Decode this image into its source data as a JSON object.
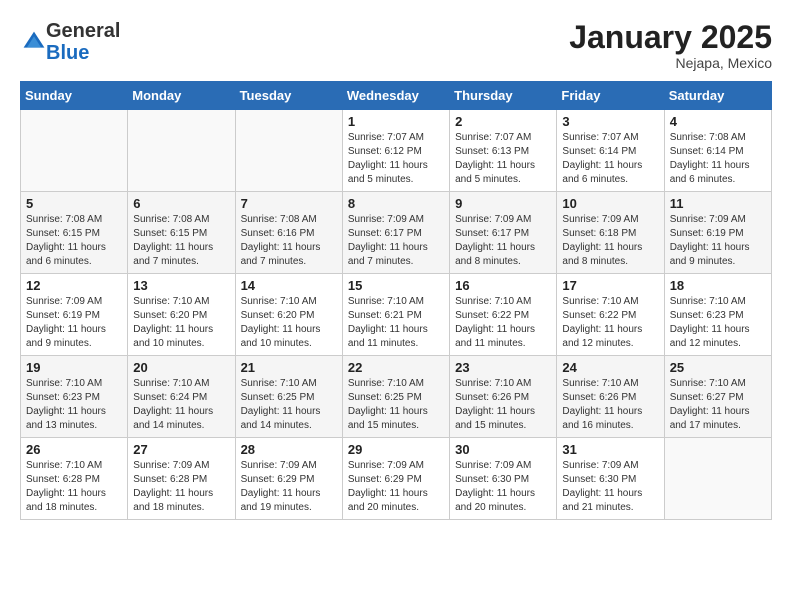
{
  "header": {
    "logo_line1": "General",
    "logo_line2": "Blue",
    "month": "January 2025",
    "location": "Nejapa, Mexico"
  },
  "weekdays": [
    "Sunday",
    "Monday",
    "Tuesday",
    "Wednesday",
    "Thursday",
    "Friday",
    "Saturday"
  ],
  "weeks": [
    [
      {
        "day": "",
        "info": ""
      },
      {
        "day": "",
        "info": ""
      },
      {
        "day": "",
        "info": ""
      },
      {
        "day": "1",
        "info": "Sunrise: 7:07 AM\nSunset: 6:12 PM\nDaylight: 11 hours\nand 5 minutes."
      },
      {
        "day": "2",
        "info": "Sunrise: 7:07 AM\nSunset: 6:13 PM\nDaylight: 11 hours\nand 5 minutes."
      },
      {
        "day": "3",
        "info": "Sunrise: 7:07 AM\nSunset: 6:14 PM\nDaylight: 11 hours\nand 6 minutes."
      },
      {
        "day": "4",
        "info": "Sunrise: 7:08 AM\nSunset: 6:14 PM\nDaylight: 11 hours\nand 6 minutes."
      }
    ],
    [
      {
        "day": "5",
        "info": "Sunrise: 7:08 AM\nSunset: 6:15 PM\nDaylight: 11 hours\nand 6 minutes."
      },
      {
        "day": "6",
        "info": "Sunrise: 7:08 AM\nSunset: 6:15 PM\nDaylight: 11 hours\nand 7 minutes."
      },
      {
        "day": "7",
        "info": "Sunrise: 7:08 AM\nSunset: 6:16 PM\nDaylight: 11 hours\nand 7 minutes."
      },
      {
        "day": "8",
        "info": "Sunrise: 7:09 AM\nSunset: 6:17 PM\nDaylight: 11 hours\nand 7 minutes."
      },
      {
        "day": "9",
        "info": "Sunrise: 7:09 AM\nSunset: 6:17 PM\nDaylight: 11 hours\nand 8 minutes."
      },
      {
        "day": "10",
        "info": "Sunrise: 7:09 AM\nSunset: 6:18 PM\nDaylight: 11 hours\nand 8 minutes."
      },
      {
        "day": "11",
        "info": "Sunrise: 7:09 AM\nSunset: 6:19 PM\nDaylight: 11 hours\nand 9 minutes."
      }
    ],
    [
      {
        "day": "12",
        "info": "Sunrise: 7:09 AM\nSunset: 6:19 PM\nDaylight: 11 hours\nand 9 minutes."
      },
      {
        "day": "13",
        "info": "Sunrise: 7:10 AM\nSunset: 6:20 PM\nDaylight: 11 hours\nand 10 minutes."
      },
      {
        "day": "14",
        "info": "Sunrise: 7:10 AM\nSunset: 6:20 PM\nDaylight: 11 hours\nand 10 minutes."
      },
      {
        "day": "15",
        "info": "Sunrise: 7:10 AM\nSunset: 6:21 PM\nDaylight: 11 hours\nand 11 minutes."
      },
      {
        "day": "16",
        "info": "Sunrise: 7:10 AM\nSunset: 6:22 PM\nDaylight: 11 hours\nand 11 minutes."
      },
      {
        "day": "17",
        "info": "Sunrise: 7:10 AM\nSunset: 6:22 PM\nDaylight: 11 hours\nand 12 minutes."
      },
      {
        "day": "18",
        "info": "Sunrise: 7:10 AM\nSunset: 6:23 PM\nDaylight: 11 hours\nand 12 minutes."
      }
    ],
    [
      {
        "day": "19",
        "info": "Sunrise: 7:10 AM\nSunset: 6:23 PM\nDaylight: 11 hours\nand 13 minutes."
      },
      {
        "day": "20",
        "info": "Sunrise: 7:10 AM\nSunset: 6:24 PM\nDaylight: 11 hours\nand 14 minutes."
      },
      {
        "day": "21",
        "info": "Sunrise: 7:10 AM\nSunset: 6:25 PM\nDaylight: 11 hours\nand 14 minutes."
      },
      {
        "day": "22",
        "info": "Sunrise: 7:10 AM\nSunset: 6:25 PM\nDaylight: 11 hours\nand 15 minutes."
      },
      {
        "day": "23",
        "info": "Sunrise: 7:10 AM\nSunset: 6:26 PM\nDaylight: 11 hours\nand 15 minutes."
      },
      {
        "day": "24",
        "info": "Sunrise: 7:10 AM\nSunset: 6:26 PM\nDaylight: 11 hours\nand 16 minutes."
      },
      {
        "day": "25",
        "info": "Sunrise: 7:10 AM\nSunset: 6:27 PM\nDaylight: 11 hours\nand 17 minutes."
      }
    ],
    [
      {
        "day": "26",
        "info": "Sunrise: 7:10 AM\nSunset: 6:28 PM\nDaylight: 11 hours\nand 18 minutes."
      },
      {
        "day": "27",
        "info": "Sunrise: 7:09 AM\nSunset: 6:28 PM\nDaylight: 11 hours\nand 18 minutes."
      },
      {
        "day": "28",
        "info": "Sunrise: 7:09 AM\nSunset: 6:29 PM\nDaylight: 11 hours\nand 19 minutes."
      },
      {
        "day": "29",
        "info": "Sunrise: 7:09 AM\nSunset: 6:29 PM\nDaylight: 11 hours\nand 20 minutes."
      },
      {
        "day": "30",
        "info": "Sunrise: 7:09 AM\nSunset: 6:30 PM\nDaylight: 11 hours\nand 20 minutes."
      },
      {
        "day": "31",
        "info": "Sunrise: 7:09 AM\nSunset: 6:30 PM\nDaylight: 11 hours\nand 21 minutes."
      },
      {
        "day": "",
        "info": ""
      }
    ]
  ]
}
